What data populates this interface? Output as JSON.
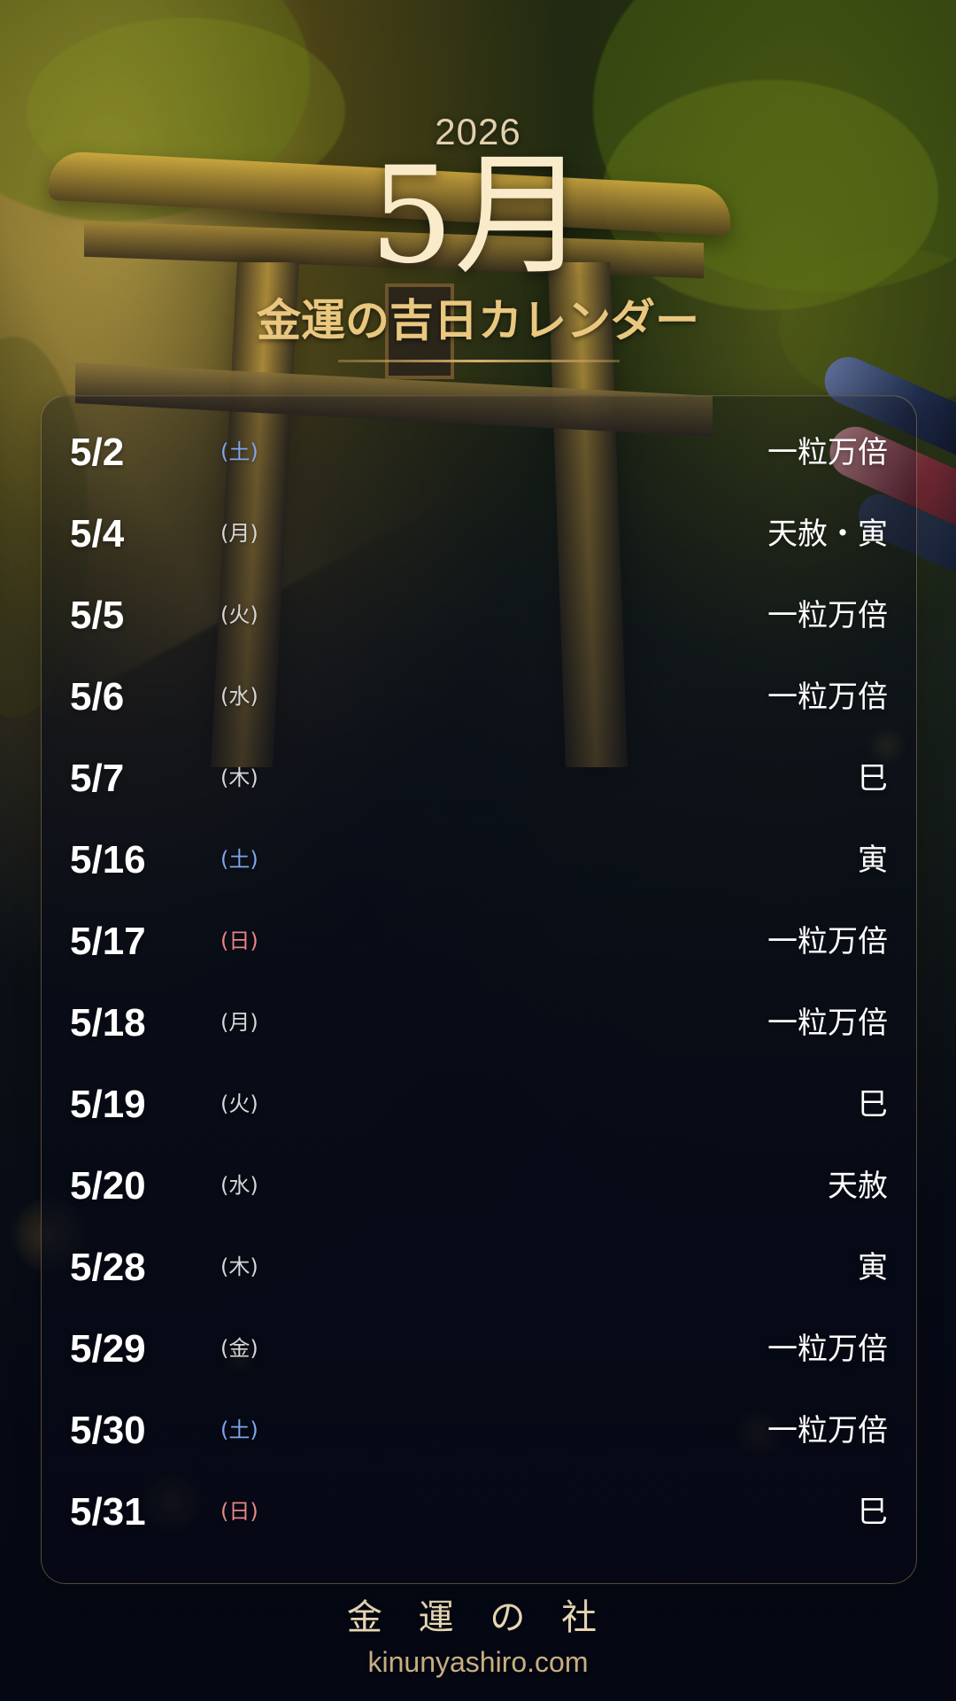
{
  "calendar": {
    "year": "2026",
    "month": "5月",
    "subtitle": "金運の吉日カレンダー",
    "entries": [
      {
        "date": "5/2",
        "weekday": "(土)",
        "fortune": "一粒万倍"
      },
      {
        "date": "5/4",
        "weekday": "(月)",
        "fortune": "天赦・寅"
      },
      {
        "date": "5/5",
        "weekday": "(火)",
        "fortune": "一粒万倍"
      },
      {
        "date": "5/6",
        "weekday": "(水)",
        "fortune": "一粒万倍"
      },
      {
        "date": "5/7",
        "weekday": "(木)",
        "fortune": "巳"
      },
      {
        "date": "5/16",
        "weekday": "(土)",
        "fortune": "寅"
      },
      {
        "date": "5/17",
        "weekday": "(日)",
        "fortune": "一粒万倍"
      },
      {
        "date": "5/18",
        "weekday": "(月)",
        "fortune": "一粒万倍"
      },
      {
        "date": "5/19",
        "weekday": "(火)",
        "fortune": "巳"
      },
      {
        "date": "5/20",
        "weekday": "(水)",
        "fortune": "天赦"
      },
      {
        "date": "5/28",
        "weekday": "(木)",
        "fortune": "寅"
      },
      {
        "date": "5/29",
        "weekday": "(金)",
        "fortune": "一粒万倍"
      },
      {
        "date": "5/30",
        "weekday": "(土)",
        "fortune": "一粒万倍"
      },
      {
        "date": "5/31",
        "weekday": "(日)",
        "fortune": "巳"
      }
    ]
  },
  "footer": {
    "shrine_name": "金 運 の 社",
    "website": "kinunyashiro.com"
  },
  "theme": {
    "saturday_color": "#7ea6ea",
    "sunday_color": "#ea8484",
    "gold_color": "#e9c77f"
  }
}
